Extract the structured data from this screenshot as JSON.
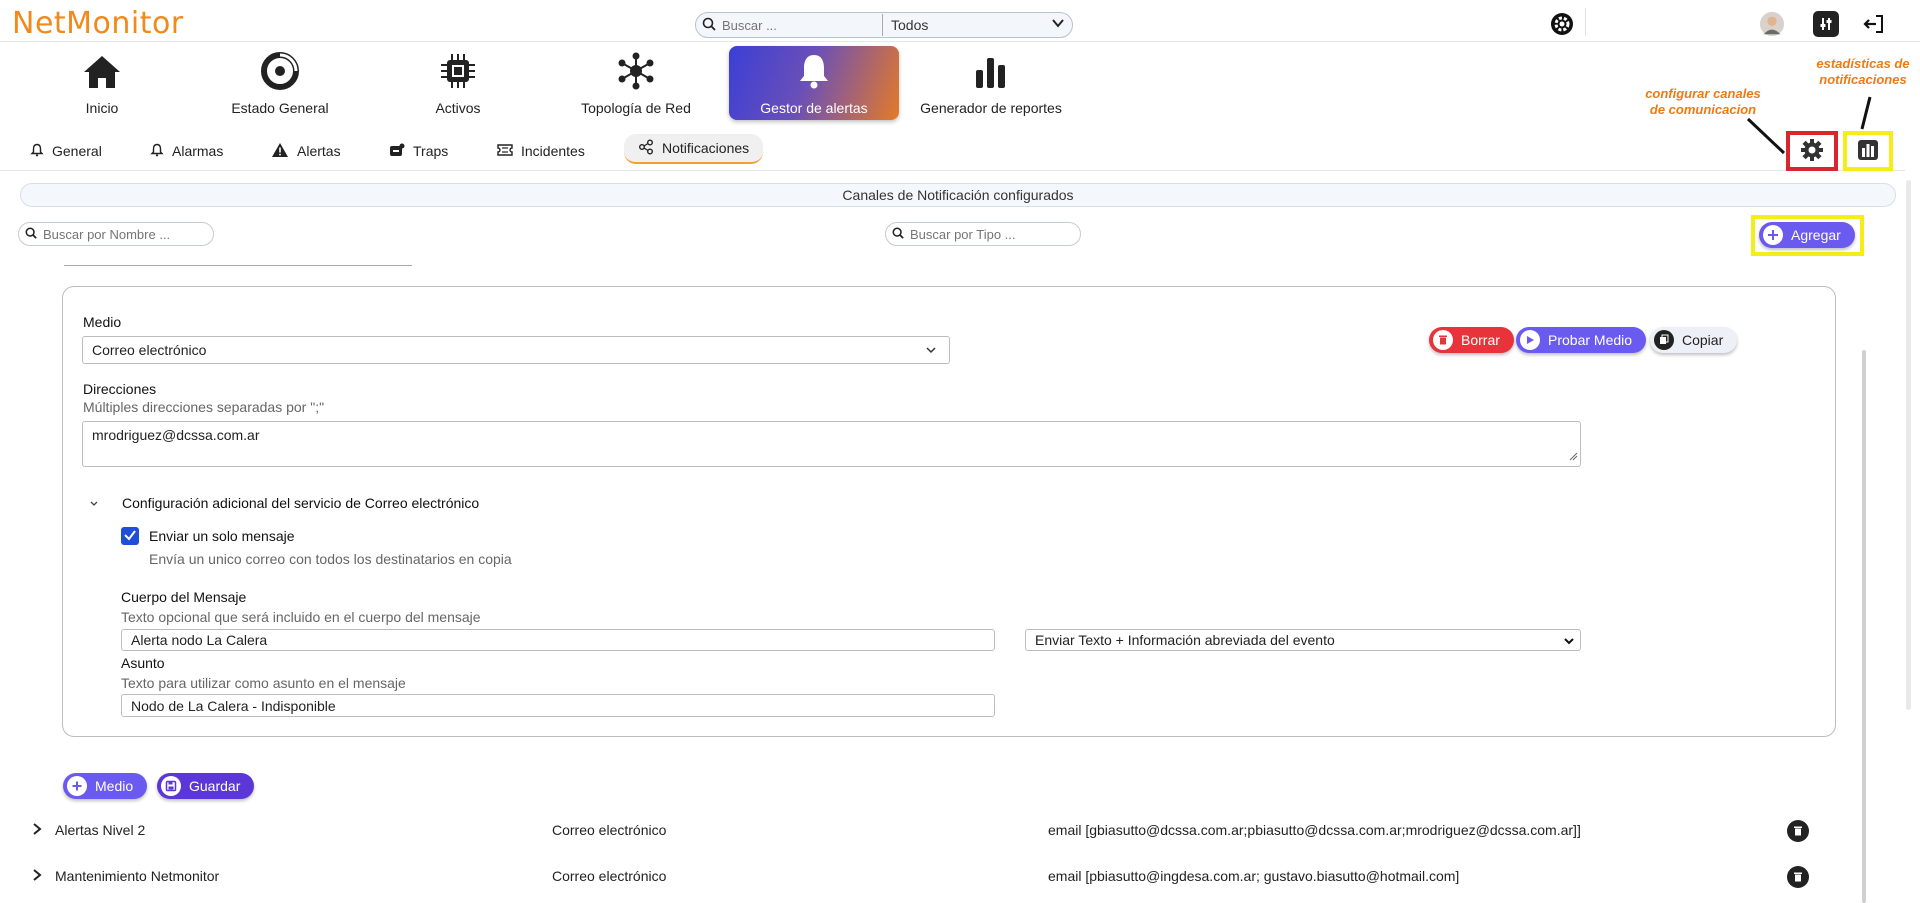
{
  "app": {
    "logo": "NetMonitor"
  },
  "topbar": {
    "search_placeholder": "Buscar ...",
    "search_scope": "Todos"
  },
  "nav": [
    {
      "label": "Inicio",
      "icon": "home-icon"
    },
    {
      "label": "Estado General",
      "icon": "dashboard-gauge-icon"
    },
    {
      "label": "Activos",
      "icon": "chip-icon"
    },
    {
      "label": "Topología de Red",
      "icon": "network-topology-icon"
    },
    {
      "label": "Gestor de alertas",
      "icon": "bell-icon",
      "active": true
    },
    {
      "label": "Generador de reportes",
      "icon": "bar-chart-icon"
    }
  ],
  "tabs": [
    {
      "label": "General",
      "icon": "bell-outline-icon"
    },
    {
      "label": "Alarmas",
      "icon": "bell-outline-icon"
    },
    {
      "label": "Alertas",
      "icon": "warning-icon"
    },
    {
      "label": "Traps",
      "icon": "trap-icon"
    },
    {
      "label": "Incidentes",
      "icon": "ticket-icon"
    },
    {
      "label": "Notificaciones",
      "icon": "share-icon",
      "active": true
    }
  ],
  "annotations": {
    "configure": "configurar canales\nde comunicacion",
    "stats": "estadísticas de\nnotificaciones"
  },
  "section": {
    "title": "Canales de Notificación configurados",
    "search_name_placeholder": "Buscar por Nombre ...",
    "search_type_placeholder": "Buscar por Tipo ...",
    "add_label": "Agregar"
  },
  "form": {
    "medio_label": "Medio",
    "medio_value": "Correo electrónico",
    "delete_label": "Borrar",
    "test_label": "Probar Medio",
    "copy_label": "Copiar",
    "direcciones_label": "Direcciones",
    "direcciones_help": "Múltiples direcciones separadas por \";\"",
    "direcciones_value": "mrodriguez@dcssa.com.ar",
    "extra_config_label": "Configuración adicional del servicio de Correo electrónico",
    "single_msg_label": "Enviar un solo mensaje",
    "single_msg_help": "Envía un unico correo con todos los destinatarios en copia",
    "single_msg_checked": true,
    "body_label": "Cuerpo del Mensaje",
    "body_help": "Texto opcional que será incluido en el cuerpo del mensaje",
    "body_value": "Alerta nodo La Calera",
    "body_mode": "Enviar Texto + Información abreviada del evento",
    "subject_label": "Asunto",
    "subject_help": "Texto para utilizar como asunto en el mensaje",
    "subject_value": "Nodo de La Calera - Indisponible"
  },
  "actions": {
    "medio_label": "Medio",
    "save_label": "Guardar"
  },
  "channels": [
    {
      "name": "Alertas Nivel 2",
      "type": "Correo electrónico",
      "target": "email [gbiasutto@dcssa.com.ar;pbiasutto@dcssa.com.ar;mrodriguez@dcssa.com.ar]]"
    },
    {
      "name": "Mantenimiento Netmonitor",
      "type": "Correo electrónico",
      "target": "email [pbiasutto@ingdesa.com.ar; gustavo.biasutto@hotmail.com]"
    }
  ],
  "colors": {
    "brand_orange": "#f08a1c",
    "accent_purple": "#6a5af0",
    "danger_red": "#e8333a",
    "highlight_yellow": "#f5ec1a",
    "highlight_red": "#d7262e"
  }
}
